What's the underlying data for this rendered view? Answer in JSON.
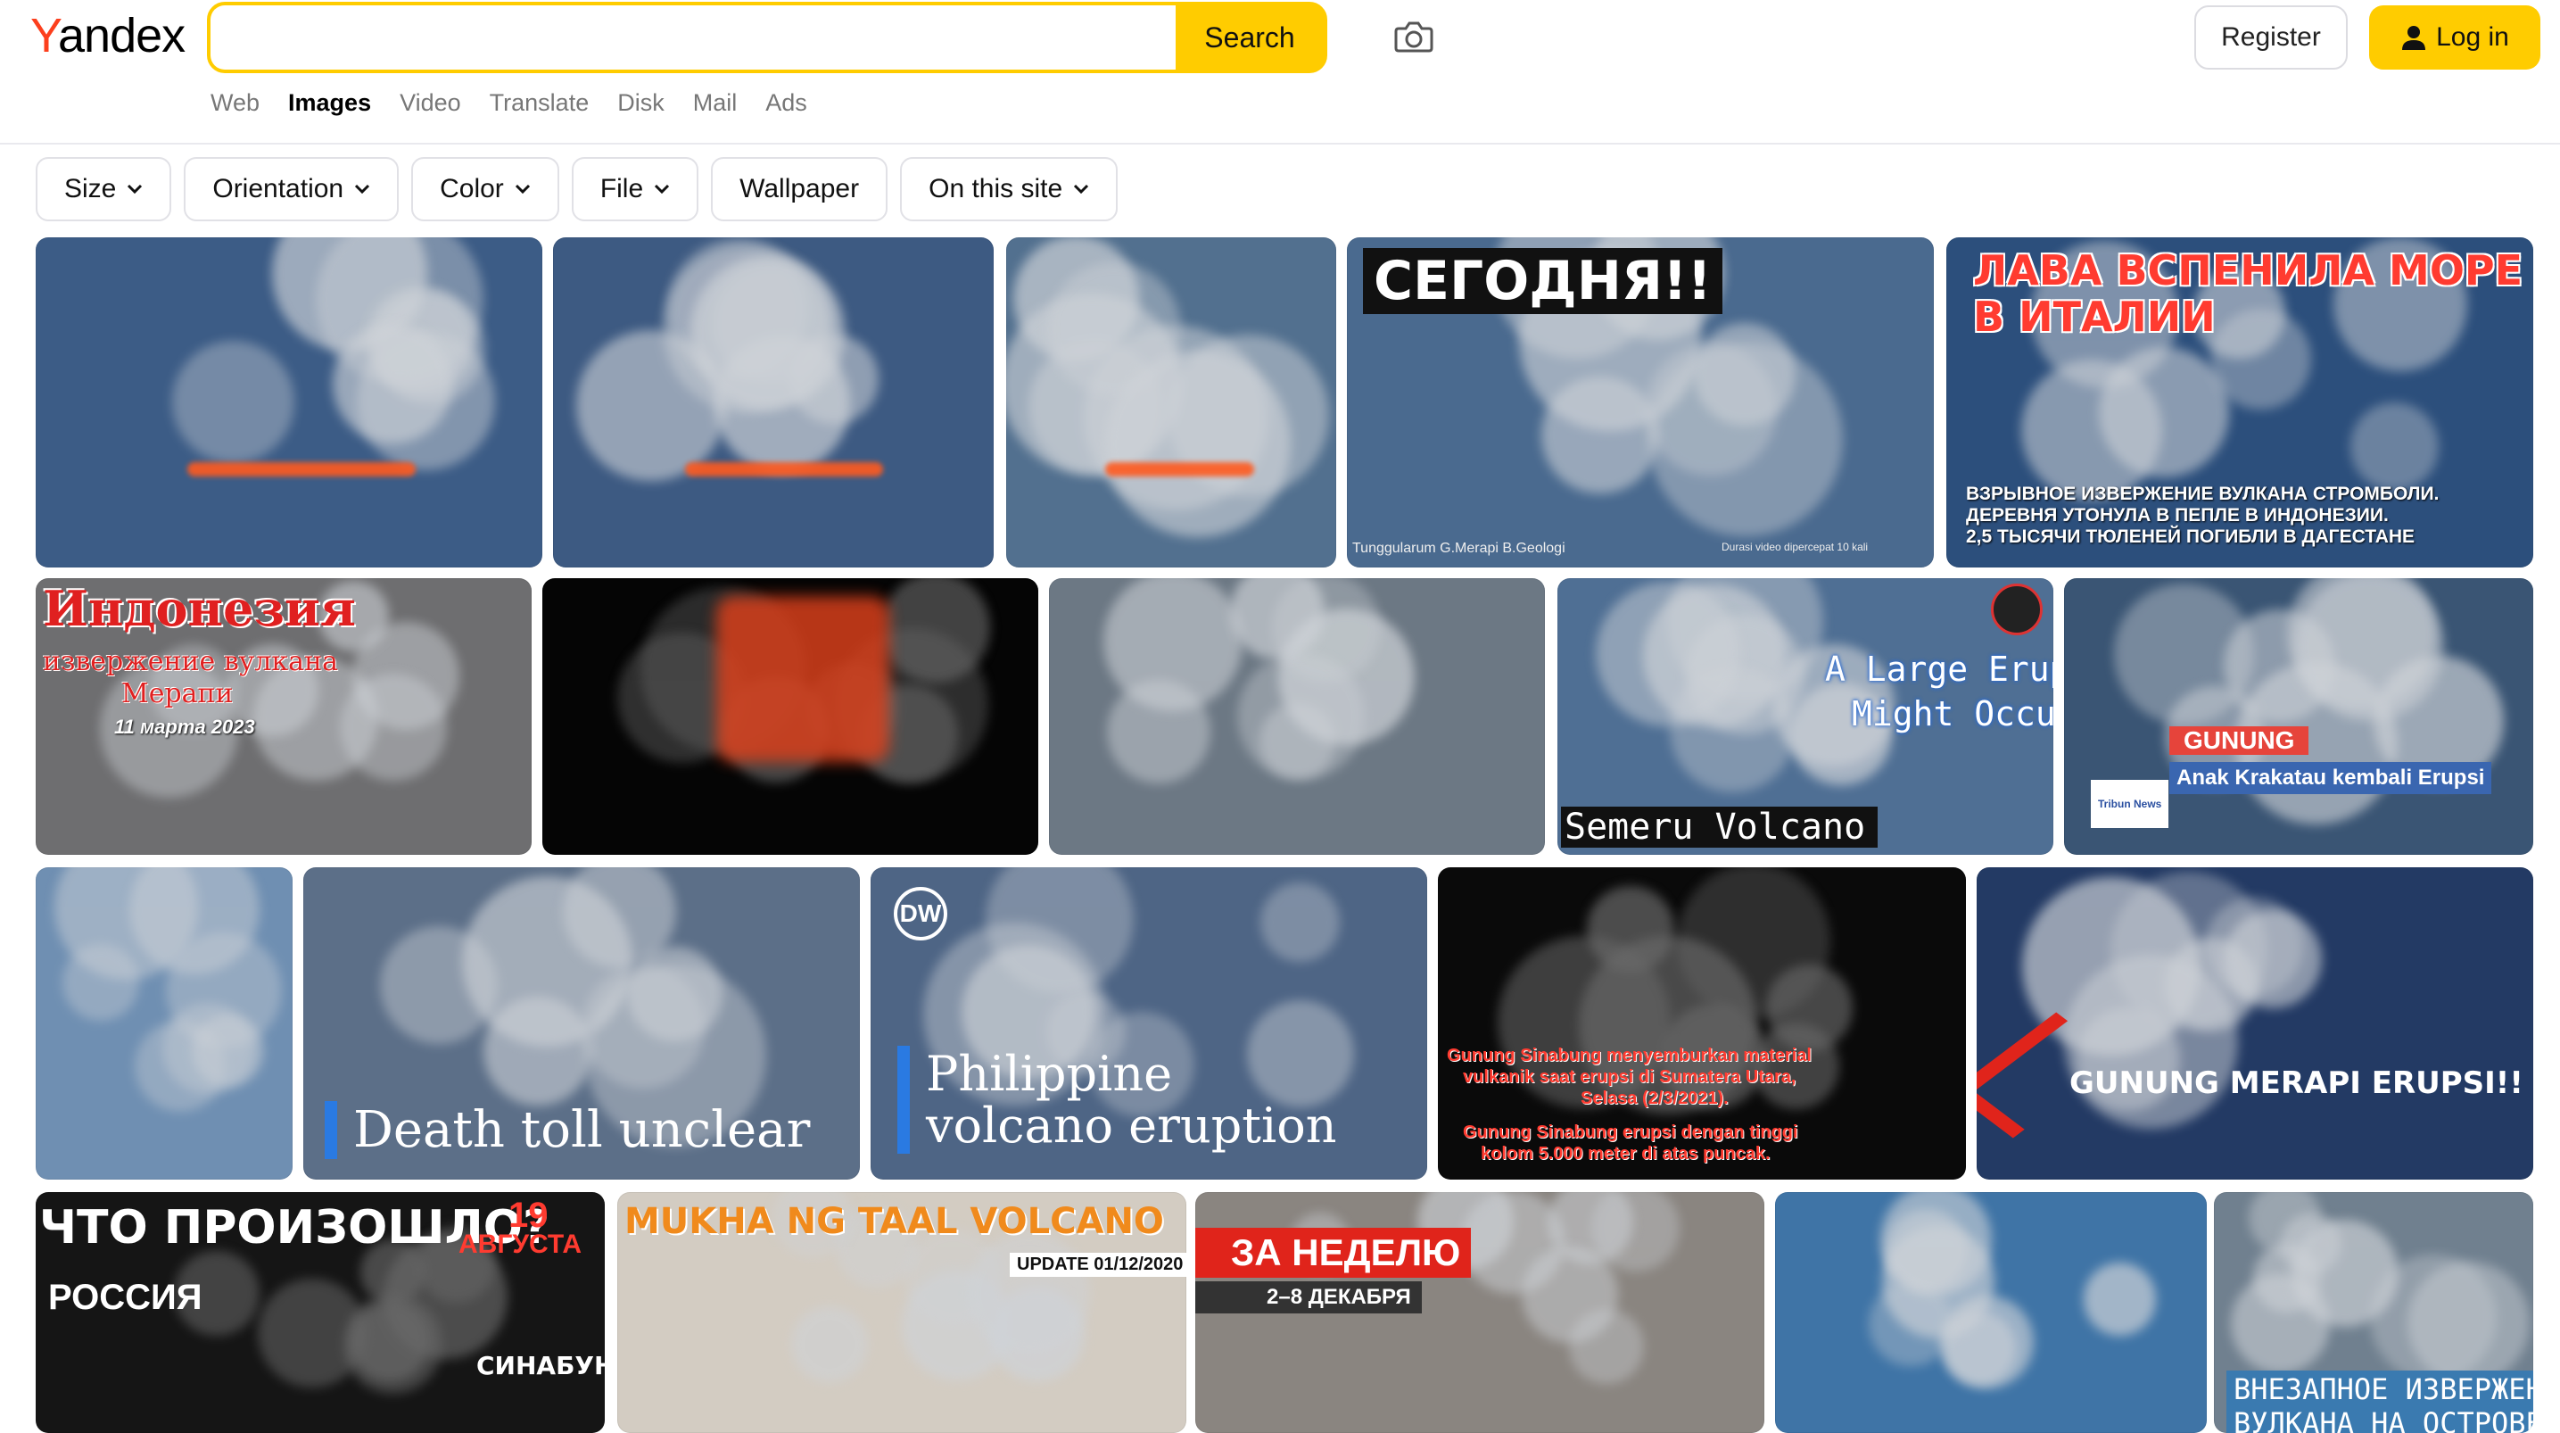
{
  "header": {
    "logo_first": "Y",
    "logo_rest": "andex",
    "search_value": "",
    "search_button": "Search",
    "register": "Register",
    "login": "Log in"
  },
  "services": [
    "Web",
    "Images",
    "Video",
    "Translate",
    "Disk",
    "Mail",
    "Ads"
  ],
  "active_service": "Images",
  "filters": [
    {
      "label": "Size",
      "dropdown": true
    },
    {
      "label": "Orientation",
      "dropdown": true
    },
    {
      "label": "Color",
      "dropdown": true
    },
    {
      "label": "File",
      "dropdown": true
    },
    {
      "label": "Wallpaper",
      "dropdown": false
    },
    {
      "label": "On this site",
      "dropdown": true
    }
  ],
  "tiles": [
    {
      "name": "aerial-eruption-1",
      "bg": "#3c5c86",
      "captions": []
    },
    {
      "name": "aerial-eruption-2",
      "bg": "#3d5a82",
      "captions": []
    },
    {
      "name": "aerial-eruption-3",
      "bg": "#52708f",
      "captions": []
    },
    {
      "name": "segodnya-merapi",
      "bg": "#4a6a8f",
      "captions": [
        "СЕГОДНЯ!!",
        "Tunggularum G.Merapi B.Geologi",
        "Durasi video dipercepat 10 kali"
      ]
    },
    {
      "name": "lava-italy",
      "bg": "#2c4f7c",
      "captions": [
        "ЛАВА ВСПЕНИЛА МОРЕ",
        "В ИТАЛИИ",
        "ВЗРЫВНОЕ ИЗВЕРЖЕНИЕ ВУЛКАНА СТРОМБОЛИ.",
        "ДЕРЕВНЯ УТОНУЛА В ПЕПЛЕ В ИНДОНЕЗИИ.",
        "2,5 ТЫСЯЧИ ТЮЛЕНЕЙ ПОГИБЛИ В ДАГЕСТАНЕ"
      ]
    },
    {
      "name": "indonesia-merapi",
      "bg": "#6e6e70",
      "captions": [
        "Индонезия",
        "извержение вулкана",
        "Мерапи",
        "11 марта 2023"
      ]
    },
    {
      "name": "lava-red-night",
      "bg": "#050505",
      "captions": []
    },
    {
      "name": "ash-cloud-river",
      "bg": "#6c7884",
      "captions": []
    },
    {
      "name": "semeru-volcano",
      "bg": "#4f6f94",
      "captions": [
        "A Large Eruption",
        "Might Occur",
        "Semeru Volcano"
      ]
    },
    {
      "name": "anak-krakatau",
      "bg": "#3a5574",
      "captions": [
        "GUNUNG",
        "Anak Krakatau kembali Erupsi",
        "Tribun News"
      ]
    },
    {
      "name": "ash-column-sky",
      "bg": "#6f8fb2",
      "captions": []
    },
    {
      "name": "death-toll",
      "bg": "#5c6f88",
      "captions": [
        "Death toll unclear"
      ]
    },
    {
      "name": "philippine-eruption",
      "bg": "#4e6585",
      "captions": [
        "DW",
        "Philippine",
        "volcano eruption"
      ]
    },
    {
      "name": "sinabung",
      "bg": "#0a0a0a",
      "captions": [
        "Gunung Sinabung menyemburkan material",
        "vulkanik saat erupsi di Sumatera Utara,",
        "Selasa (2/3/2021).",
        "Gunung Sinabung erupsi dengan tinggi",
        "kolom 5.000 meter di atas puncak."
      ]
    },
    {
      "name": "merapi-erupsi",
      "bg": "#233a64",
      "captions": [
        "GUNUNG MERAPI ERUPSI!!"
      ]
    },
    {
      "name": "chto-proizoshlo",
      "bg": "#151515",
      "captions": [
        "ЧТО ПРОИЗОШЛО?",
        "19",
        "АВГУСТА",
        "РОССИЯ",
        "СИНАБУНГ"
      ]
    },
    {
      "name": "taal-volcano",
      "bg": "#d3ccc2",
      "captions": [
        "MUKHA NG TAAL VOLCANO",
        "UPDATE 01/12/2020"
      ]
    },
    {
      "name": "za-nedelyu",
      "bg": "#8a8580",
      "captions": [
        "ЗА НЕДЕЛЮ",
        "2–8 ДЕКАБРЯ"
      ]
    },
    {
      "name": "orange-ash-cloud",
      "bg": "#3f74a6",
      "captions": []
    },
    {
      "name": "java-eruption",
      "bg": "#70808f",
      "captions": [
        "ВНЕЗАПНОЕ ИЗВЕРЖЕНИЕ",
        "ВУЛКАНА НА ОСТРОВЕ ЯВА"
      ]
    }
  ]
}
